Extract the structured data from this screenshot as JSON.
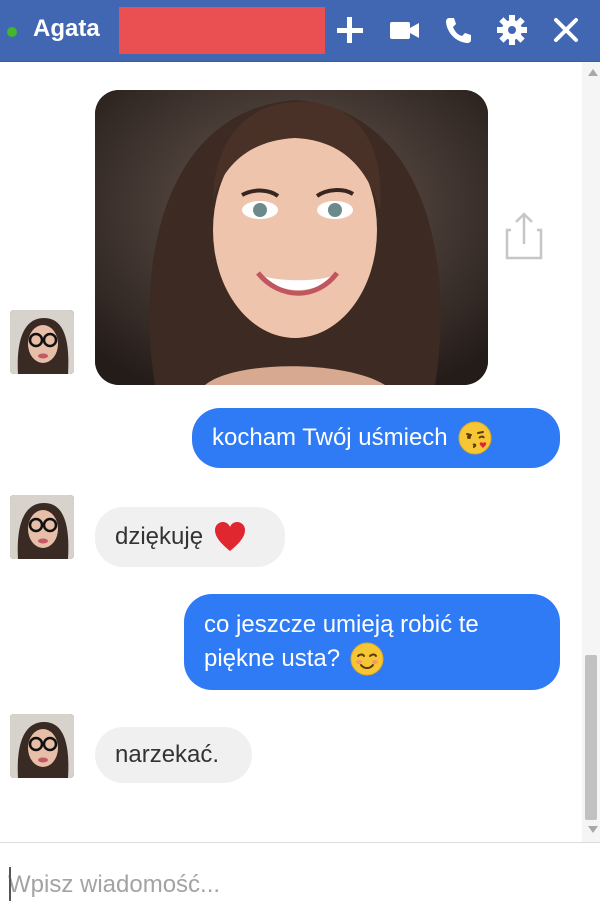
{
  "header": {
    "contact_name": "Agata",
    "status": "online",
    "buttons": [
      "add-icon",
      "video-camera-icon",
      "phone-icon",
      "gear-icon",
      "close-icon"
    ],
    "colors": {
      "bar": "#4267b2",
      "status_dot": "#42b72a",
      "redaction": "#ea4f52"
    }
  },
  "messages": [
    {
      "direction": "incoming",
      "type": "image",
      "content": "photo"
    },
    {
      "direction": "outgoing",
      "text": "kocham Twój uśmiech",
      "emoji": "kissing-face-icon"
    },
    {
      "direction": "incoming",
      "text": "dziękuję",
      "emoji": "red-heart-icon"
    },
    {
      "direction": "outgoing",
      "text_line1": "co jeszcze umieją robić te",
      "text_line2": "piękne usta?",
      "emoji": "smiling-face-icon"
    },
    {
      "direction": "incoming",
      "text": "narzekać."
    }
  ],
  "composer": {
    "placeholder": "Wpisz wiadomość..."
  },
  "colors": {
    "outgoing_bubble": "#2f7bf6",
    "incoming_bubble": "#f0f0f0"
  }
}
